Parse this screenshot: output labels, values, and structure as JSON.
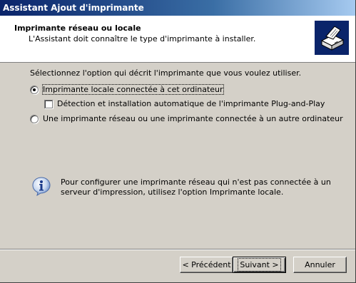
{
  "window": {
    "title": "Assistant Ajout d'imprimante"
  },
  "header": {
    "title": "Imprimante réseau ou locale",
    "subtitle": "L'Assistant doit connaître le type d'imprimante à installer.",
    "icon": "printer-wizard-icon"
  },
  "content": {
    "instruction": "Sélectionnez l'option qui décrit l'imprimante que vous voulez utiliser.",
    "options": [
      {
        "label": "Imprimante locale connectée à cet ordinateur",
        "type": "radio",
        "checked": true
      },
      {
        "label": "Détection et installation automatique de l'imprimante Plug-and-Play",
        "type": "checkbox",
        "checked": false
      },
      {
        "label": "Une imprimante réseau ou une imprimante connectée à un autre ordinateur",
        "type": "radio",
        "checked": false
      }
    ],
    "info": {
      "icon": "info-icon",
      "line1": "Pour configurer une imprimante réseau qui n'est pas connectée à un",
      "line2": "serveur d'impression, utilisez l'option Imprimante locale."
    }
  },
  "buttons": {
    "back": "< Précédent",
    "next": "Suivant >",
    "cancel": "Annuler"
  },
  "colors": {
    "title_bar": "#0a246a",
    "face": "#d4d0c8",
    "header_bg": "#ffffff"
  }
}
